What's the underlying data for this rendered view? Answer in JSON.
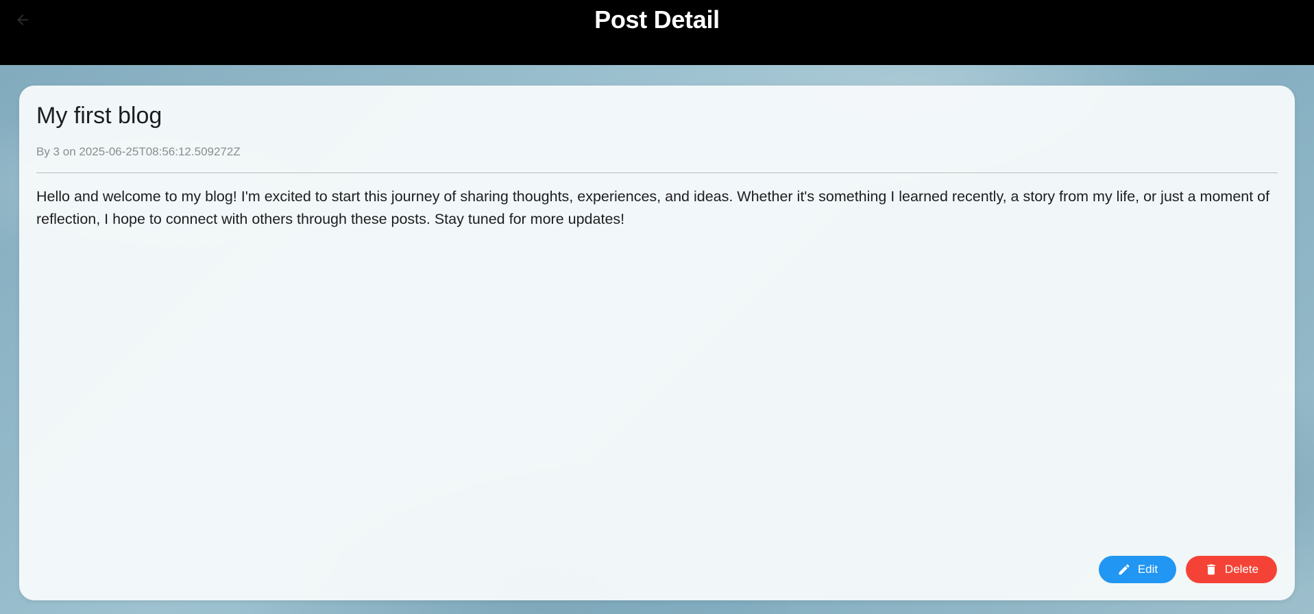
{
  "app_bar": {
    "title": "Post Detail",
    "back_icon": "arrow-back-icon"
  },
  "post": {
    "title": "My first blog",
    "meta": "By 3 on 2025-06-25T08:56:12.509272Z",
    "body": "Hello and welcome to my blog! I'm excited to start this journey of sharing thoughts, experiences, and ideas. Whether it's something I learned recently, a story from my life, or just a moment of reflection, I hope to connect with others through these posts. Stay tuned for more updates!"
  },
  "actions": {
    "edit_label": "Edit",
    "edit_icon": "pencil-icon",
    "edit_color": "#2196f3",
    "delete_label": "Delete",
    "delete_icon": "trash-icon",
    "delete_color": "#f44336"
  },
  "colors": {
    "app_bar": "#000000",
    "card": "#f7fafb",
    "text": "#1c1d1f",
    "meta": "#8a8d90"
  }
}
